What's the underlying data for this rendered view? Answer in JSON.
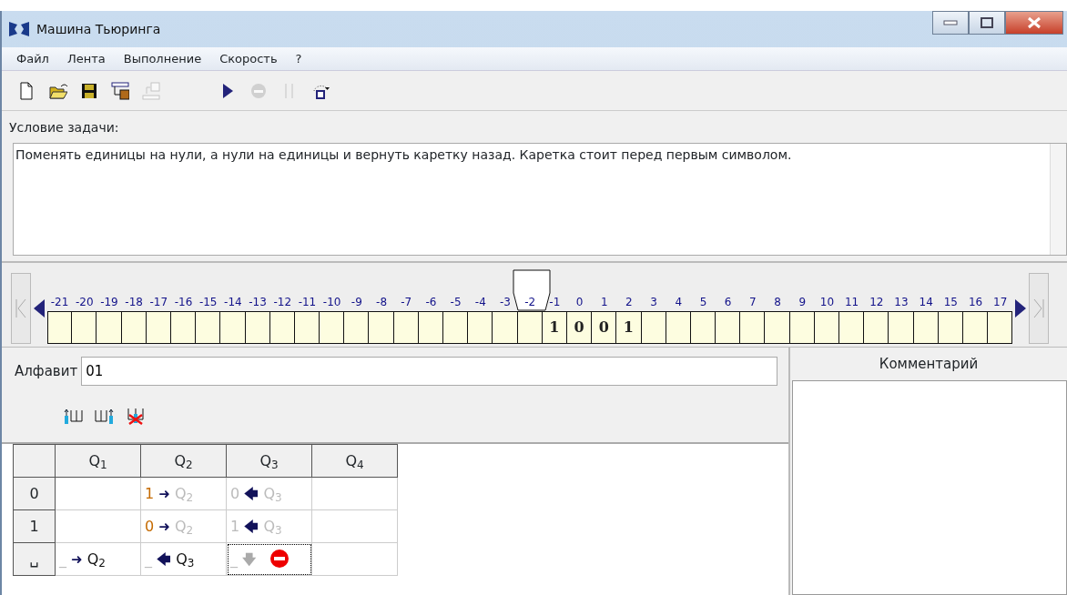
{
  "window": {
    "title": "Машина Тьюринга"
  },
  "menu": [
    "Файл",
    "Лента",
    "Выполнение",
    "Скорость",
    "?"
  ],
  "toolbar": [
    {
      "kind": "new",
      "disabled": false
    },
    {
      "kind": "open",
      "disabled": false
    },
    {
      "kind": "save",
      "disabled": false
    },
    {
      "kind": "tape-in",
      "disabled": false
    },
    {
      "kind": "tape-out",
      "disabled": true
    },
    {
      "kind": "gap"
    },
    {
      "kind": "run",
      "disabled": false
    },
    {
      "kind": "stop",
      "disabled": true
    },
    {
      "kind": "pause",
      "disabled": true
    },
    {
      "kind": "step",
      "disabled": false
    }
  ],
  "task": {
    "label": "Условие задачи:",
    "text": "Поменять единицы на нули, а нули на единицы и вернуть каретку назад. Каретка стоит перед первым символом."
  },
  "tape": {
    "cells": [
      {
        "index": "-21",
        "head": false
      },
      {
        "index": "-20",
        "head": false
      },
      {
        "index": "-19",
        "head": false
      },
      {
        "index": "-18",
        "head": false
      },
      {
        "index": "-17",
        "head": false
      },
      {
        "index": "-16",
        "head": false
      },
      {
        "index": "-15",
        "head": false
      },
      {
        "index": "-14",
        "head": false
      },
      {
        "index": "-13",
        "head": false
      },
      {
        "index": "-12",
        "head": false
      },
      {
        "index": "-11",
        "head": false
      },
      {
        "index": "-10",
        "head": false
      },
      {
        "index": "-9",
        "head": false
      },
      {
        "index": "-8",
        "head": false
      },
      {
        "index": "-7",
        "head": false
      },
      {
        "index": "-6",
        "head": false
      },
      {
        "index": "-5",
        "head": false
      },
      {
        "index": "-4",
        "head": false
      },
      {
        "index": "-3",
        "head": false
      },
      {
        "index": "-2",
        "head": true
      },
      {
        "index": "-1",
        "value": "1"
      },
      {
        "index": "0",
        "value": "0"
      },
      {
        "index": "1",
        "value": "0"
      },
      {
        "index": "2",
        "value": "1"
      },
      {
        "index": "3"
      },
      {
        "index": "4"
      },
      {
        "index": "5"
      },
      {
        "index": "6"
      },
      {
        "index": "7"
      },
      {
        "index": "8"
      },
      {
        "index": "9"
      },
      {
        "index": "10"
      },
      {
        "index": "11"
      },
      {
        "index": "12"
      },
      {
        "index": "13"
      },
      {
        "index": "14"
      },
      {
        "index": "15"
      },
      {
        "index": "16"
      },
      {
        "index": "17"
      }
    ]
  },
  "alphabet": {
    "label": "Алфавит",
    "value": "01"
  },
  "table": {
    "columns": [
      "Q$_{1}$",
      "Q$_{2}$",
      "Q$_{3}$",
      "Q$_{4}$"
    ],
    "rows": [
      {
        "symbol": "0",
        "cells": [
          null,
          {
            "symbol": "1",
            "symbol_changed": true,
            "move": "➜",
            "move_active": true,
            "state": "Q$_{2}$",
            "state_changed": false,
            "selected": false
          },
          {
            "symbol": "0",
            "symbol_changed": false,
            "move": "🡄",
            "move_active": true,
            "state": "Q$_{3}$",
            "state_changed": false,
            "selected": false
          },
          null
        ]
      },
      {
        "symbol": "1",
        "cells": [
          null,
          {
            "symbol": "0",
            "symbol_changed": true,
            "move": "➜",
            "move_active": true,
            "state": "Q$_{2}$",
            "state_changed": false,
            "selected": false
          },
          {
            "symbol": "1",
            "symbol_changed": false,
            "move": "🡄",
            "move_active": true,
            "state": "Q$_{3}$",
            "state_changed": false,
            "selected": false
          },
          null
        ]
      },
      {
        "symbol": "␣",
        "cells": [
          {
            "symbol": "_",
            "symbol_changed": false,
            "move": "➜",
            "move_active": true,
            "state": "Q$_{2}$",
            "state_changed": true,
            "selected": false
          },
          {
            "symbol": "_",
            "symbol_changed": false,
            "move": "🡄",
            "move_active": true,
            "state": "Q$_{3}$",
            "state_changed": true,
            "selected": false
          },
          {
            "symbol": "_",
            "symbol_changed": false,
            "move": "🡇",
            "move_active": false,
            "halt": true,
            "selected": true
          },
          null
        ]
      }
    ]
  },
  "comment": {
    "title": "Комментарий"
  }
}
